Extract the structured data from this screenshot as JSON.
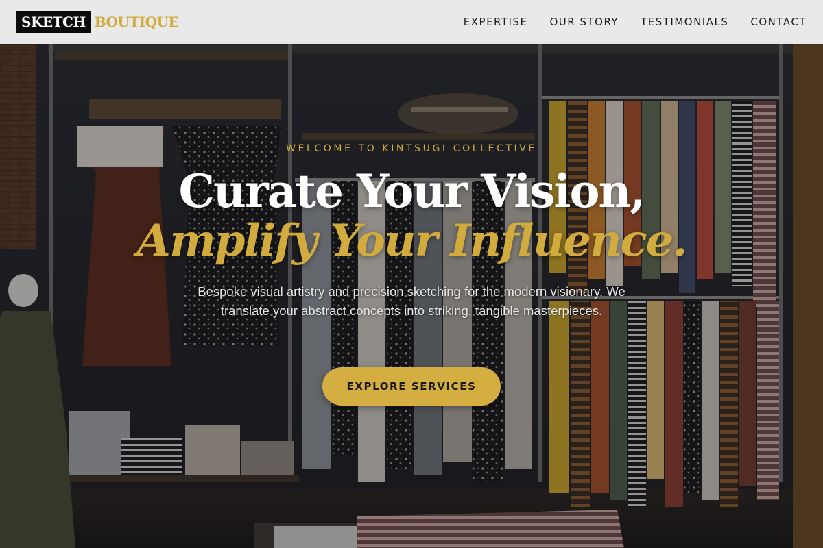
{
  "header": {
    "logo_part1": "SKETCH",
    "logo_part2": "BOUTIQUE",
    "nav": [
      "EXPERTISE",
      "OUR STORY",
      "TESTIMONIALS",
      "CONTACT"
    ]
  },
  "hero": {
    "eyebrow": "WELCOME TO KINTSUGI COLLECTIVE",
    "headline_line1": "Curate Your Vision,",
    "headline_line2": "Amplify Your Influence.",
    "description": "Bespoke visual artistry and precision sketching for the modern visionary. We translate your abstract concepts into striking, tangible masterpieces.",
    "cta_label": "EXPLORE SERVICES",
    "background_icon": "boutique-clothing-rack-photo"
  },
  "colors": {
    "accent_gold": "#d1ab3e",
    "header_bg": "#e9e9ea",
    "logo_dark": "#0a0a0a"
  }
}
